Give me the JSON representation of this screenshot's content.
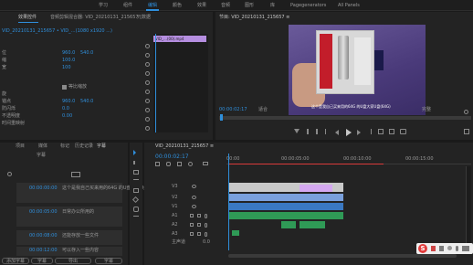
{
  "workspace_tabs": [
    "学习",
    "组件",
    "编辑",
    "颜色",
    "效果",
    "音频",
    "图形",
    "库",
    "Pagegenerators",
    "All Panels"
  ],
  "workspace_active": 2,
  "effect_controls": {
    "tabs": [
      "效果控件",
      "音频剪辑混合器: VID_20210131_215657",
      "元数据"
    ],
    "clip_label": "VID_20210131_215657 • VID_…(1080 x1920 ...)",
    "mini_clip": "VID_…(00).mp4",
    "values": [
      "960.0",
      "540.0",
      "100.0",
      "100",
      "960.0",
      "540.0",
      "0.0",
      "0.00"
    ],
    "uniform_scale": "等比缩放"
  },
  "program_monitor": {
    "title": "节目: VID_20210131_215657 ≡",
    "timecode": "00:00:02:17",
    "fit": "适合",
    "quality": "完整",
    "subtitle": "这个是我自己买来用的64G 的U盘大家U盘(64G)"
  },
  "project_panel": {
    "tabs": [
      "项目",
      "媒体",
      "标记",
      "历史记录",
      "字幕"
    ],
    "subtab": "字幕",
    "rows": [
      {
        "time": "00:00:00:00",
        "text": "这个是我自己买来用的64G 的U盘大家U盘(64G)"
      },
      {
        "time": "00:00:05:00",
        "text": "日常办公所用的"
      },
      {
        "time": "00:00:08:00",
        "text": "还能存放一些文件"
      },
      {
        "time": "00:00:12:00",
        "text": "可以存入一些内容"
      }
    ],
    "buttons": [
      "添加字幕",
      "字幕",
      "导出",
      "字幕"
    ]
  },
  "timeline": {
    "tab": "VID_20210131_215657 ≡",
    "timecode": "00:00:02:17",
    "ruler": [
      "00:00",
      "00:00:05:00",
      "00:00:10:00",
      "00:00:15:00"
    ],
    "video_tracks": [
      "V3",
      "V2",
      "V1"
    ],
    "audio_tracks": [
      "A1",
      "A2",
      "A3"
    ],
    "master": "主声道",
    "master_value": "0.0"
  },
  "subtitle_overlay": "S"
}
